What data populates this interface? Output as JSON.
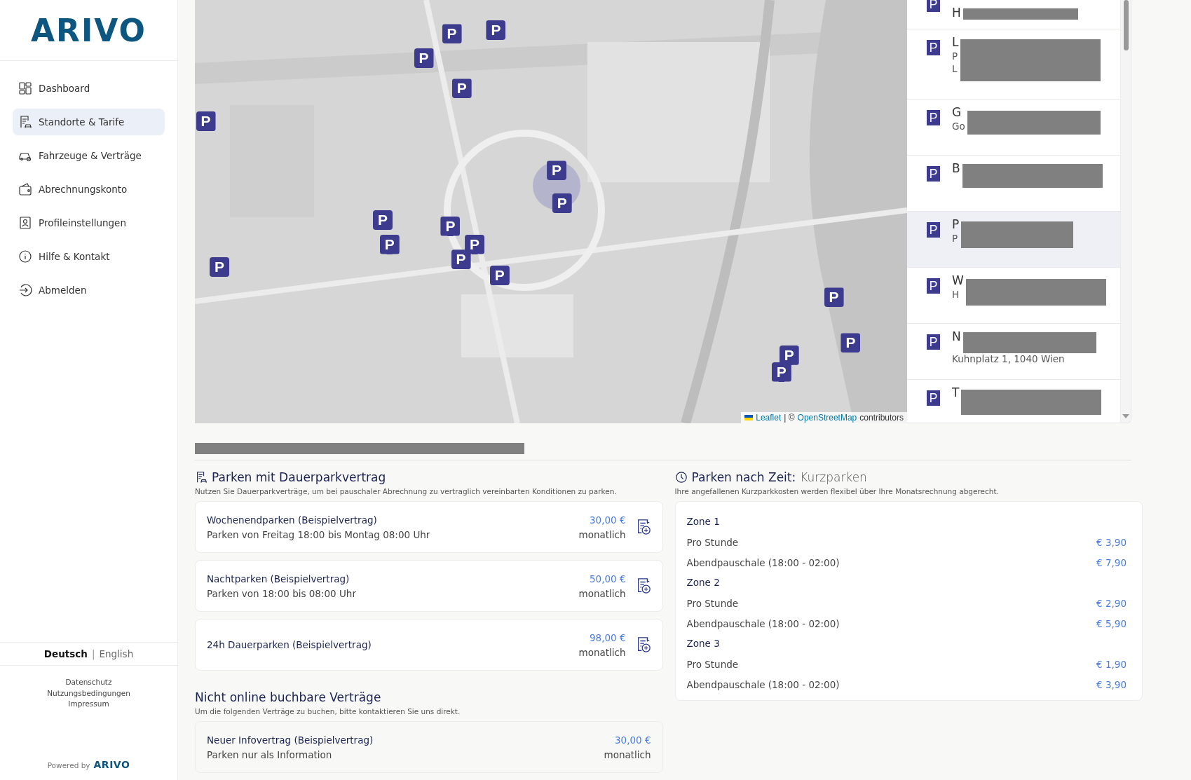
{
  "brand": {
    "logo": "ARIVO"
  },
  "nav": [
    {
      "label": "Dashboard",
      "selected": false
    },
    {
      "label": "Standorte & Tarife",
      "selected": true
    },
    {
      "label": "Fahrzeuge & Verträge",
      "selected": false
    },
    {
      "label": "Abrechnungskonto",
      "selected": false
    },
    {
      "label": "Profileinstellungen",
      "selected": false
    },
    {
      "label": "Hilfe & Kontakt",
      "selected": false
    },
    {
      "label": "Abmelden",
      "selected": false
    }
  ],
  "language": {
    "separator": "|",
    "options": [
      {
        "label": "Deutsch",
        "selected": true
      },
      {
        "label": "English",
        "selected": false
      }
    ]
  },
  "footer_links": [
    "Datenschutz",
    "Nutzungsbedingungen",
    "Impressum"
  ],
  "powered_by": {
    "text": "Powered by",
    "logo": "ARIVO"
  },
  "map": {
    "markers": [
      {
        "label": "P"
      },
      {
        "label": "P"
      },
      {
        "label": "P"
      },
      {
        "label": "P"
      },
      {
        "label": "P"
      },
      {
        "label": "P"
      },
      {
        "label": "P"
      },
      {
        "label": "P"
      },
      {
        "label": "P"
      },
      {
        "label": "P"
      },
      {
        "label": "P"
      },
      {
        "label": "P"
      },
      {
        "label": "P"
      },
      {
        "label": "P"
      },
      {
        "label": "P"
      },
      {
        "label": "P"
      },
      {
        "label": "P"
      },
      {
        "label": "P"
      }
    ],
    "attribution": {
      "leaflet": "Leaflet",
      "separator": "| ©",
      "osm": "OpenStreetMap",
      "suffix": "contributors"
    }
  },
  "locations": [
    {
      "icon": "P",
      "lines": [
        "H"
      ],
      "selected": false
    },
    {
      "icon": "P",
      "lines": [
        "L",
        "P",
        "L"
      ],
      "selected": false
    },
    {
      "icon": "P",
      "lines": [
        "G",
        "Go"
      ],
      "selected": false
    },
    {
      "icon": "P",
      "lines": [
        "B"
      ],
      "selected": false
    },
    {
      "icon": "P",
      "lines": [
        "P",
        "P"
      ],
      "selected": true
    },
    {
      "icon": "P",
      "lines": [
        "W",
        "H"
      ],
      "selected": false
    },
    {
      "icon": "P",
      "lines": [
        "N"
      ],
      "address": "Kuhnplatz 1, 1040 Wien",
      "selected": false
    },
    {
      "icon": "P",
      "lines": [
        "T"
      ],
      "selected": false
    }
  ],
  "contracts": {
    "title": "Parken mit Dauerparkvertrag",
    "subtitle": "Nutzen Sie Dauerparkverträge, um bei pauschaler Abrechnung zu vertraglich vereinbarten Konditionen zu parken.",
    "items": [
      {
        "title": "Wochenendparken (Beispielvertrag)",
        "description": "Parken von Freitag 18:00 bis Montag 08:00 Uhr",
        "price": "30,00 €",
        "period": "monatlich"
      },
      {
        "title": "Nachtparken (Beispielvertrag)",
        "description": "Parken von 18:00 bis 08:00 Uhr",
        "price": "50,00 €",
        "period": "monatlich"
      },
      {
        "title": "24h Dauerparken (Beispielvertrag)",
        "price": "98,00 €",
        "period": "monatlich"
      }
    ]
  },
  "offline_contracts": {
    "title": "Nicht online buchbare Verträge",
    "subtitle": "Um die folgenden Verträge zu buchen, bitte kontaktieren Sie uns direkt.",
    "items": [
      {
        "title": "Neuer Infovertrag (Beispielvertrag)",
        "description": "Parken nur als Information",
        "price": "30,00 €",
        "period": "monatlich"
      }
    ]
  },
  "short_term": {
    "title": "Parken nach Zeit:",
    "title_suffix": "Kurzparken",
    "subtitle": "Ihre angefallenen Kurzparkkosten werden flexibel über Ihre Monatsrechnung abgerecht.",
    "zones": [
      {
        "name": "Zone 1",
        "rates": [
          {
            "label": "Pro Stunde",
            "price": "€ 3,90"
          },
          {
            "label": "Abendpauschale (18:00 - 02:00)",
            "price": "€ 7,90"
          }
        ]
      },
      {
        "name": "Zone 2",
        "rates": [
          {
            "label": "Pro Stunde",
            "price": "€ 2,90"
          },
          {
            "label": "Abendpauschale (18:00 - 02:00)",
            "price": "€ 5,90"
          }
        ]
      },
      {
        "name": "Zone 3",
        "rates": [
          {
            "label": "Pro Stunde",
            "price": "€ 1,90"
          },
          {
            "label": "Abendpauschale (18:00 - 02:00)",
            "price": "€ 3,90"
          }
        ]
      }
    ]
  }
}
